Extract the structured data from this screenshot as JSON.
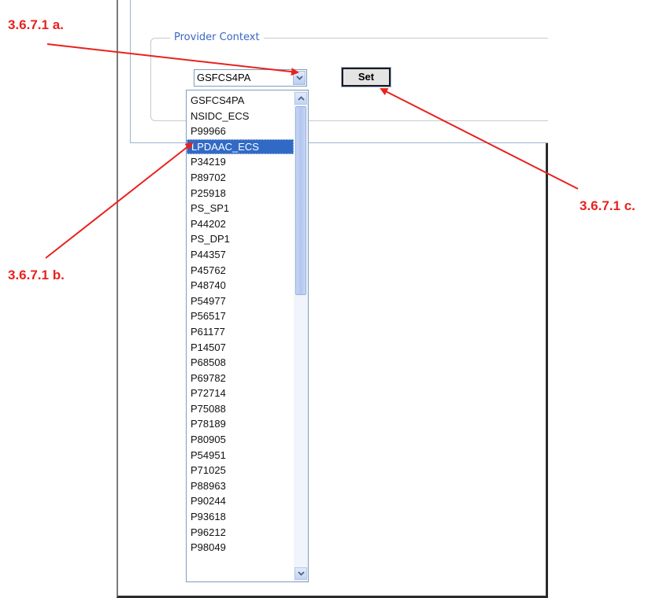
{
  "provider_context": {
    "legend": "Provider Context",
    "select_value": "GSFCS4PA",
    "set_button_label": "Set",
    "options": [
      "GSFCS4PA",
      "NSIDC_ECS",
      "P99966",
      "LPDAAC_ECS",
      "P34219",
      "P89702",
      "P25918",
      "PS_SP1",
      "P44202",
      "PS_DP1",
      "P44357",
      "P45762",
      "P48740",
      "P54977",
      "P56517",
      "P61177",
      "P14507",
      "P68508",
      "P69782",
      "P72714",
      "P75088",
      "P78189",
      "P80905",
      "P54951",
      "P71025",
      "P88963",
      "P90244",
      "P93618",
      "P96212",
      "P98049"
    ],
    "highlighted_option": "LPDAAC_ECS"
  },
  "annotations": {
    "a": "3.6.7.1 a.",
    "b": "3.6.7.1 b.",
    "c": "3.6.7.1 c."
  },
  "colors": {
    "annotation": "#e8221d",
    "legend": "#3a66c4",
    "selection": "#316ac5"
  },
  "icons": {
    "dropdown": "chevron-down-icon",
    "scroll_up": "chevron-up-icon",
    "scroll_down": "chevron-down-icon"
  }
}
